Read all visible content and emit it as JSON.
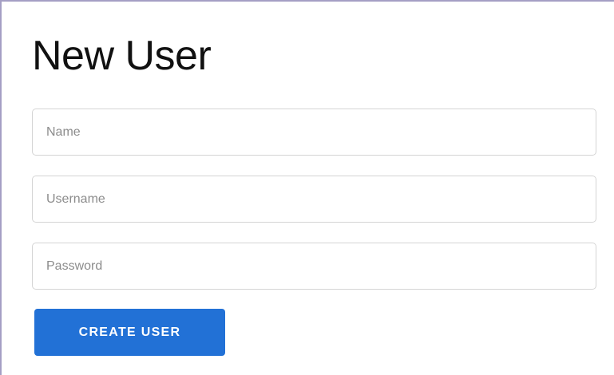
{
  "form": {
    "title": "New User",
    "fields": {
      "name": {
        "value": "",
        "placeholder": "Name"
      },
      "username": {
        "value": "",
        "placeholder": "Username"
      },
      "password": {
        "value": "",
        "placeholder": "Password"
      }
    },
    "submit_label": "CREATE USER"
  },
  "colors": {
    "accent": "#2271d6",
    "border": "#d4d4d4",
    "frame_border": "#a59fc4"
  }
}
